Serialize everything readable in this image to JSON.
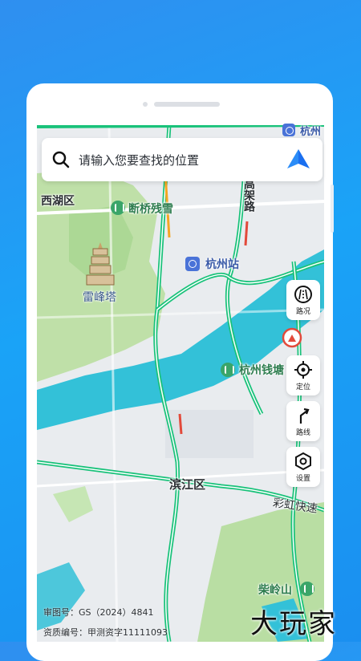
{
  "search": {
    "placeholder": "请输入您要查找的位置",
    "search_icon": "search-icon",
    "nav_icon": "navigation-arrow-icon"
  },
  "controls": [
    {
      "label": "路况",
      "icon": "road-condition-icon"
    },
    {
      "label": "定位",
      "icon": "locate-icon"
    },
    {
      "label": "路线",
      "icon": "route-icon"
    },
    {
      "label": "设置",
      "icon": "settings-icon"
    }
  ],
  "map_labels": {
    "district_xihu": "西湖区",
    "duanqiao": "断桥残雪",
    "leifengta": "雷峰塔",
    "hangzhou_station": "杭州站",
    "qiantang": "杭州钱塘",
    "binjiang": "滨江区",
    "caihong": "彩虹快速",
    "chailingshan": "柴岭山",
    "hangzhou_top": "杭州",
    "gaojia": "高架路"
  },
  "footer": {
    "approval": "审图号：GS（2024）4841",
    "qualification": "资质编号：甲测资字11111093"
  },
  "watermark": "大玩家",
  "colors": {
    "water": "#33c1d8",
    "green_area": "#b9dea3",
    "road_green": "#19c27a",
    "accent_blue": "#1a8ff0"
  }
}
